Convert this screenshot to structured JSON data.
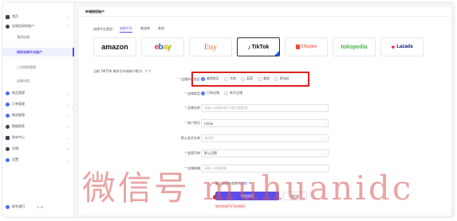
{
  "sidebar": {
    "items": [
      {
        "label": "首页",
        "icon": "grid-icon"
      },
      {
        "label": "店铺及授权账户",
        "icon": "store-icon"
      },
      {
        "label": "商品管理",
        "icon": "box-icon"
      },
      {
        "label": "订单管理",
        "icon": "order-icon"
      },
      {
        "label": "物流管理",
        "icon": "truck-icon"
      },
      {
        "label": "数据报表",
        "icon": "chart-icon"
      },
      {
        "label": "财务中心",
        "icon": "wallet-icon"
      },
      {
        "label": "仓储",
        "icon": "warehouse-icon"
      },
      {
        "label": "设置",
        "icon": "gear-icon"
      }
    ],
    "subitems": [
      {
        "label": "我的店铺"
      },
      {
        "label": "授权电商平台账户",
        "active": true
      },
      {
        "label": "三方授权管理"
      },
      {
        "label": "店铺分组"
      }
    ],
    "footer": {
      "label": "联系我们",
      "controls": "⟲ ⊞"
    }
  },
  "main": {
    "title": "申请授权账户",
    "platform_label": "选择平台类型：",
    "platform_tabs": [
      {
        "label": "电商平台",
        "active": true
      },
      {
        "label": "物流商",
        "active": false
      },
      {
        "label": "其他",
        "active": false
      }
    ],
    "logos": [
      {
        "name": "amazon",
        "text": "amazon"
      },
      {
        "name": "ebay",
        "text": "ebay"
      },
      {
        "name": "etsy",
        "text": "Etsy"
      },
      {
        "name": "tiktok",
        "text": "TikTok",
        "selected": true
      },
      {
        "name": "shopee",
        "text": "Shopee"
      },
      {
        "name": "tokopedia",
        "text": "tokopedia"
      },
      {
        "name": "lazada",
        "text": "Lazada"
      }
    ],
    "shop_count_text": "当前 TIKTOK 剩余可申请账户数为：1 个",
    "form": {
      "region": {
        "label": "店铺所在地区",
        "options": [
          {
            "label": "美国地区",
            "on": true
          },
          {
            "label": "东南",
            "on": false
          },
          {
            "label": "英国",
            "on": false
          },
          {
            "label": "美国",
            "on": false
          },
          {
            "label": "欧洲区",
            "on": false
          }
        ]
      },
      "type": {
        "label": "店铺类型",
        "options": [
          {
            "label": "已有店铺",
            "on": true
          },
          {
            "label": "新开店铺",
            "on": false
          }
        ]
      },
      "name": {
        "label": "店铺名称",
        "placeholder": "请输入店铺名称(方便后期管理)"
      },
      "account": {
        "label": "账户简写",
        "value": "tiktok"
      },
      "warehouse": {
        "label": "默认发货仓库",
        "placeholder": "请选择"
      },
      "currency": {
        "label": "经营币种",
        "value": "默认设置"
      },
      "email": {
        "label": "店铺邮箱",
        "placeholder": "请输入店铺邮箱"
      }
    },
    "auth_info": {
      "prefix": "默认授权有效期",
      "link": "(长期)"
    },
    "buttons": {
      "primary": "前往授权",
      "cancel": "取消"
    },
    "help_link": "如何申请TikTok授权?"
  },
  "watermark": "微信号 muhuanidc"
}
